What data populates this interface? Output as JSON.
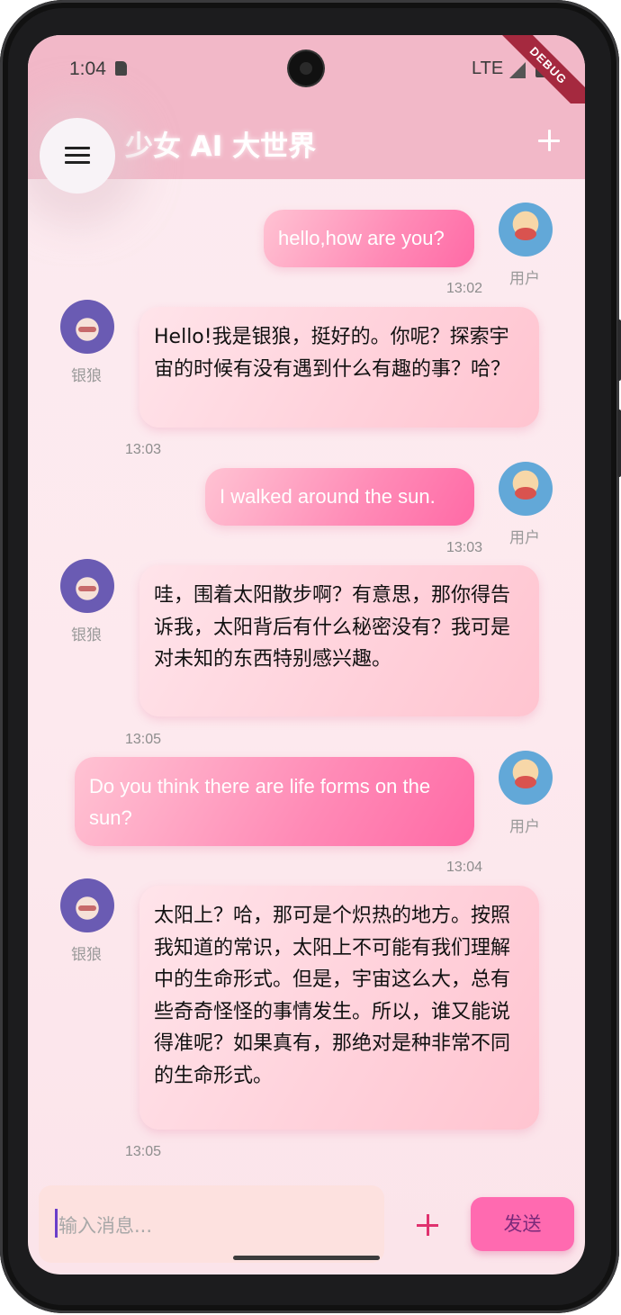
{
  "status_bar": {
    "time": "1:04",
    "network": "LTE",
    "debug_banner": "DEBUG"
  },
  "app_bar": {
    "title": "少女 AI 大世界"
  },
  "messages": [
    {
      "sender": "user",
      "name": "用户",
      "text": "hello,how are you?",
      "time": "13:02"
    },
    {
      "sender": "bot",
      "name": "银狼",
      "text": "Hello!我是银狼，挺好的。你呢？探索宇宙的时候有没有遇到什么有趣的事？哈？",
      "time": "13:03"
    },
    {
      "sender": "user",
      "name": "用户",
      "text": "I walked around the sun.",
      "time": "13:03"
    },
    {
      "sender": "bot",
      "name": "银狼",
      "text": "哇，围着太阳散步啊？有意思，那你得告诉我，太阳背后有什么秘密没有？我可是对未知的东西特别感兴趣。",
      "time": "13:05"
    },
    {
      "sender": "user",
      "name": "用户",
      "text": "Do you think there are life forms on the sun?",
      "time": "13:04"
    },
    {
      "sender": "bot",
      "name": "银狼",
      "text": "太阳上？哈，那可是个炽热的地方。按照我知道的常识，太阳上不可能有我们理解中的生命形式。但是，宇宙这么大，总有些奇奇怪怪的事情发生。所以，谁又能说得准呢？如果真有，那绝对是种非常不同的生命形式。",
      "time": "13:05"
    }
  ],
  "composer": {
    "placeholder": "输入消息...",
    "send_label": "发送"
  },
  "icons": {
    "menu": "hamburger-menu-icon",
    "add": "plus-icon",
    "attach": "plus-icon"
  },
  "colors": {
    "app_bar": "#f2b8c8",
    "user_bubble": "#ff7fb0",
    "bot_bubble": "#ffd3dc",
    "send_button": "#ff6ab0"
  }
}
